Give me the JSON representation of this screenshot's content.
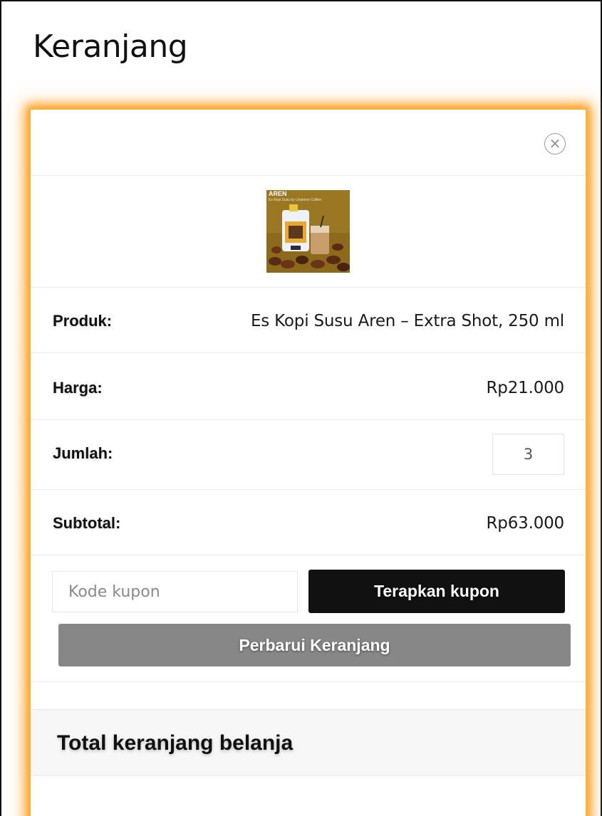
{
  "page": {
    "title": "Keranjang"
  },
  "cart_item": {
    "remove_icon": "close-circle-icon",
    "image": {
      "heading": "AREN",
      "caption": "Es Kopi Susu by Unalome Coffee"
    },
    "rows": {
      "product": {
        "label": "Produk:",
        "value": "Es Kopi Susu Aren – Extra Shot, 250 ml"
      },
      "price": {
        "label": "Harga:",
        "value": "Rp21.000"
      },
      "quantity": {
        "label": "Jumlah:",
        "value": "3"
      },
      "subtotal": {
        "label": "Subtotal:",
        "value": "Rp63.000"
      }
    }
  },
  "coupon": {
    "placeholder": "Kode kupon",
    "apply_label": "Terapkan kupon"
  },
  "update_label": "Perbarui Keranjang",
  "totals": {
    "title": "Total keranjang belanja"
  },
  "colors": {
    "accent_glow": "#ff9d14",
    "primary_button": "#111111",
    "secondary_button": "#878787"
  }
}
